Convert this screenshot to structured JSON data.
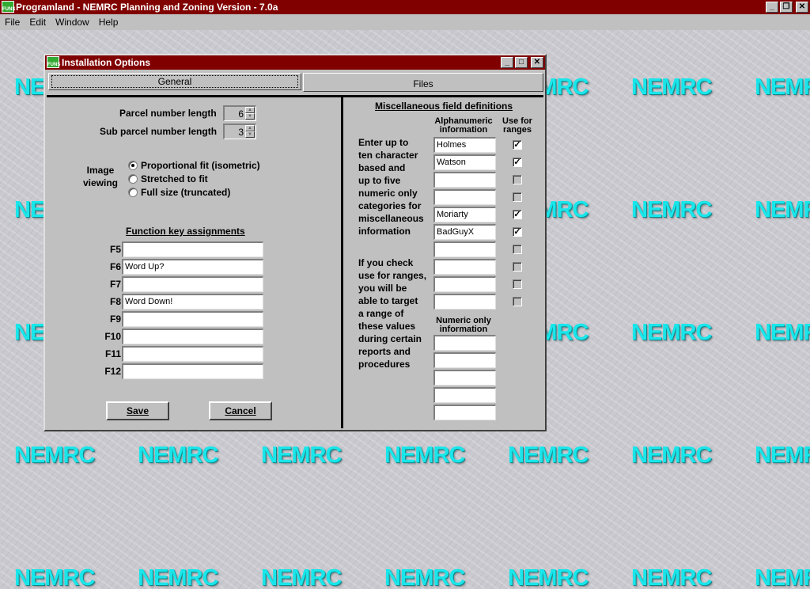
{
  "app": {
    "icon_text": "FUNS",
    "title": "Programland - NEMRC Planning and Zoning Version - 7.0a",
    "minimize": "_",
    "restore": "❐",
    "close": "✕"
  },
  "menu": [
    {
      "label": "File"
    },
    {
      "label": "Edit"
    },
    {
      "label": "Window"
    },
    {
      "label": "Help"
    }
  ],
  "watermark": "NEMRC",
  "dialog": {
    "title": "Installation Options",
    "minimize": "_",
    "maximize": "□",
    "close": "✕",
    "tabs": {
      "general": "General",
      "files": "Files"
    },
    "parcel_length_label": "Parcel number length",
    "parcel_length_value": "6",
    "sub_parcel_length_label": "Sub parcel number length",
    "sub_parcel_length_value": "3",
    "image_viewing_label_1": "Image",
    "image_viewing_label_2": "viewing",
    "image_options": [
      {
        "label": "Proportional fit (isometric)",
        "selected": true
      },
      {
        "label": "Stretched to fit",
        "selected": false
      },
      {
        "label": "Full size (truncated)",
        "selected": false
      }
    ],
    "function_keys_title": "Function key assignments",
    "function_keys": [
      {
        "key": "F5",
        "value": ""
      },
      {
        "key": "F6",
        "value": "Word Up?"
      },
      {
        "key": "F7",
        "value": ""
      },
      {
        "key": "F8",
        "value": "Word Down!"
      },
      {
        "key": "F9",
        "value": ""
      },
      {
        "key": "F10",
        "value": ""
      },
      {
        "key": "F11",
        "value": ""
      },
      {
        "key": "F12",
        "value": ""
      }
    ],
    "save_label": "Save",
    "cancel_label": "Cancel",
    "misc": {
      "title": "Miscellaneous field definitions",
      "alpha_head_1": "Alphanumeric",
      "alpha_head_2": "information",
      "range_head_1": "Use for",
      "range_head_2": "ranges",
      "numeric_head_1": "Numeric only",
      "numeric_head_2": "information",
      "para1": [
        "Enter up to",
        "ten character",
        "based and",
        "up to five",
        "numeric only",
        "categories for",
        "miscellaneous",
        "information"
      ],
      "para2": [
        "If you check",
        "use for ranges,",
        "you will be",
        "able to target",
        "a range of",
        "these values",
        "during certain",
        "reports and",
        "procedures"
      ],
      "alpha_fields": [
        {
          "value": "Holmes",
          "range": true
        },
        {
          "value": "Watson",
          "range": true
        },
        {
          "value": "",
          "range": false
        },
        {
          "value": "",
          "range": false
        },
        {
          "value": "Moriarty",
          "range": true
        },
        {
          "value": "BadGuyX",
          "range": true
        },
        {
          "value": "",
          "range": false
        },
        {
          "value": "",
          "range": false
        },
        {
          "value": "",
          "range": false
        },
        {
          "value": "",
          "range": false
        }
      ],
      "numeric_fields": [
        "",
        "",
        "",
        "",
        ""
      ]
    }
  }
}
